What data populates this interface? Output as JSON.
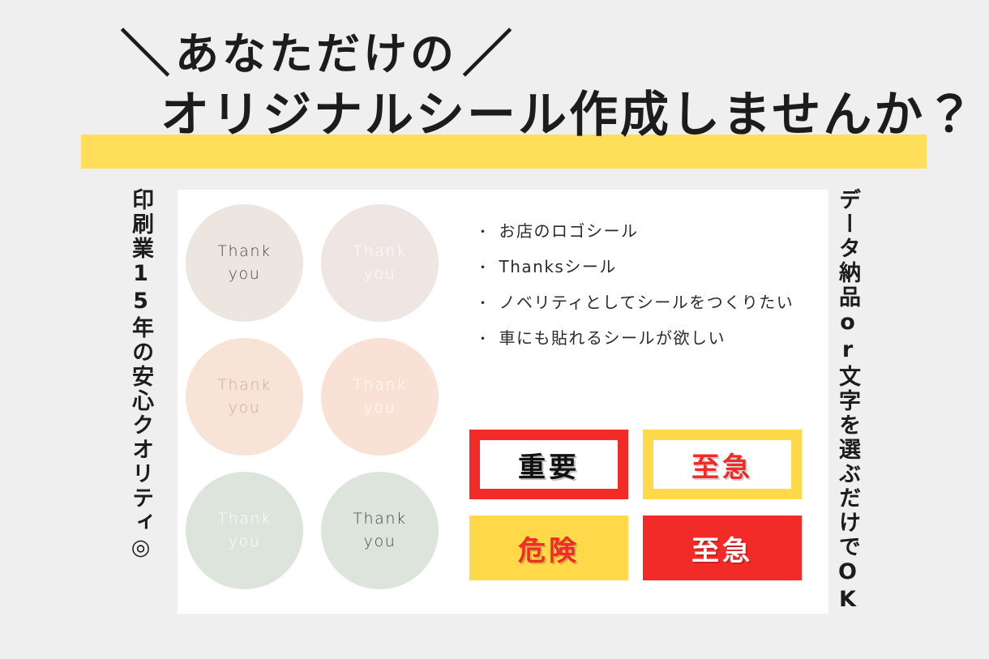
{
  "page": {
    "background_color": "#efefef"
  },
  "headline": {
    "slash_left": "＼",
    "slash_right": "／",
    "line1": "あなただけの",
    "line2": "オリジナルシール作成しませんか？",
    "highlight_color": "#FFDE59"
  },
  "captions": {
    "left": "印刷業15年の安心クオリティ◎",
    "right": "データ納品or文字を選ぶだけでOK"
  },
  "card": {
    "background_color": "#ffffff"
  },
  "stickers": {
    "label_line1": "Thank",
    "label_line2": "you",
    "items": [
      {
        "name": "sticker-taupe-dark-text",
        "bg": "#EDE5E0",
        "text_color": "#4a4542"
      },
      {
        "name": "sticker-taupe-white-text",
        "bg": "#EFE5E2",
        "text_color": "#ffffff"
      },
      {
        "name": "sticker-peach-muted-text",
        "bg": "#F8E3D7",
        "text_color": "#c9ab98"
      },
      {
        "name": "sticker-peach-white-text",
        "bg": "#F9E2D5",
        "text_color": "#ffffff"
      },
      {
        "name": "sticker-sage-white-text",
        "bg": "#DCE4DC",
        "text_color": "#ffffff"
      },
      {
        "name": "sticker-sage-dark-text",
        "bg": "#DCE4DC",
        "text_color": "#3f4744"
      }
    ]
  },
  "bullets": [
    "お店のロゴシール",
    "Thanksシール",
    "ノベリティとしてシールをつくりたい",
    "車にも貼れるシールが欲しい"
  ],
  "bullet_marker": "・",
  "labels": [
    {
      "text": "重要",
      "style": "style-outline-red",
      "name": "label-important"
    },
    {
      "text": "至急",
      "style": "style-outline-yellow",
      "name": "label-urgent-outline"
    },
    {
      "text": "危険",
      "style": "style-solid-yellow",
      "name": "label-danger"
    },
    {
      "text": "至急",
      "style": "style-solid-red",
      "name": "label-urgent-solid"
    }
  ],
  "colors": {
    "red": "#F22B28",
    "yellow": "#FFD94A",
    "highlight_yellow": "#FFDE59",
    "ink": "#1c1c1c"
  }
}
